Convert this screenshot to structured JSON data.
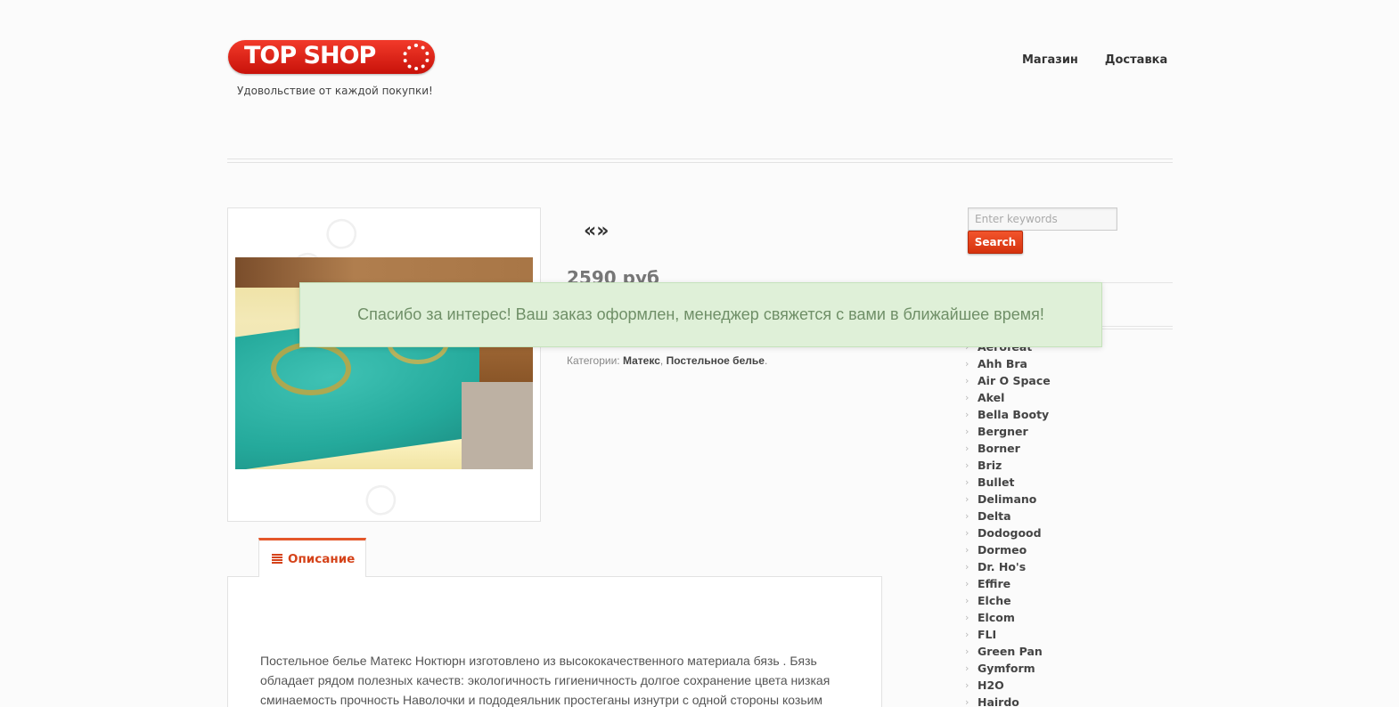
{
  "brand": {
    "logo_text": "TOP SHOP",
    "tagline": "Удовольствие от каждой покупки!"
  },
  "nav": {
    "items": [
      {
        "label": "Магазин"
      },
      {
        "label": "Доставка"
      }
    ]
  },
  "product": {
    "pager": "«»",
    "price": "2590 руб",
    "categories_label": "Категории:",
    "categories": [
      "Матекс",
      "Постельное белье"
    ],
    "categories_separator": ",",
    "categories_end": "."
  },
  "notice": {
    "message": "Спасибо за интерес! Ваш заказ оформлен, менеджер свяжется с вами в ближайшее время!"
  },
  "search": {
    "placeholder": "Enter keywords",
    "button_label": "Search"
  },
  "brands": [
    "Aerofeat",
    "Ahh Bra",
    "Air O Space",
    "Akel",
    "Bella Booty",
    "Bergner",
    "Borner",
    "Briz",
    "Bullet",
    "Delimano",
    "Delta",
    "Dodogood",
    "Dormeo",
    "Dr. Ho's",
    "Effire",
    "Elche",
    "Elcom",
    "FLI",
    "Green Pan",
    "Gymform",
    "H2O",
    "Hairdo"
  ],
  "tabs": [
    {
      "label": "Описание",
      "icon": "list-icon"
    }
  ],
  "description": "Постельное белье Матекс Ноктюрн изготовлено из высококачественного материала бязь . Бязь обладает рядом полезных качеств: экологичность гигиеничность долгое сохранение цвета низкая сминаемость прочность Наволочки и пододеяльник простеганы изнутри с одной стороны козьим",
  "colors": {
    "accent": "#e4572a",
    "logo_red": "#e0261a",
    "notice_bg": "#dff0d8",
    "notice_text": "#6f8f67"
  }
}
